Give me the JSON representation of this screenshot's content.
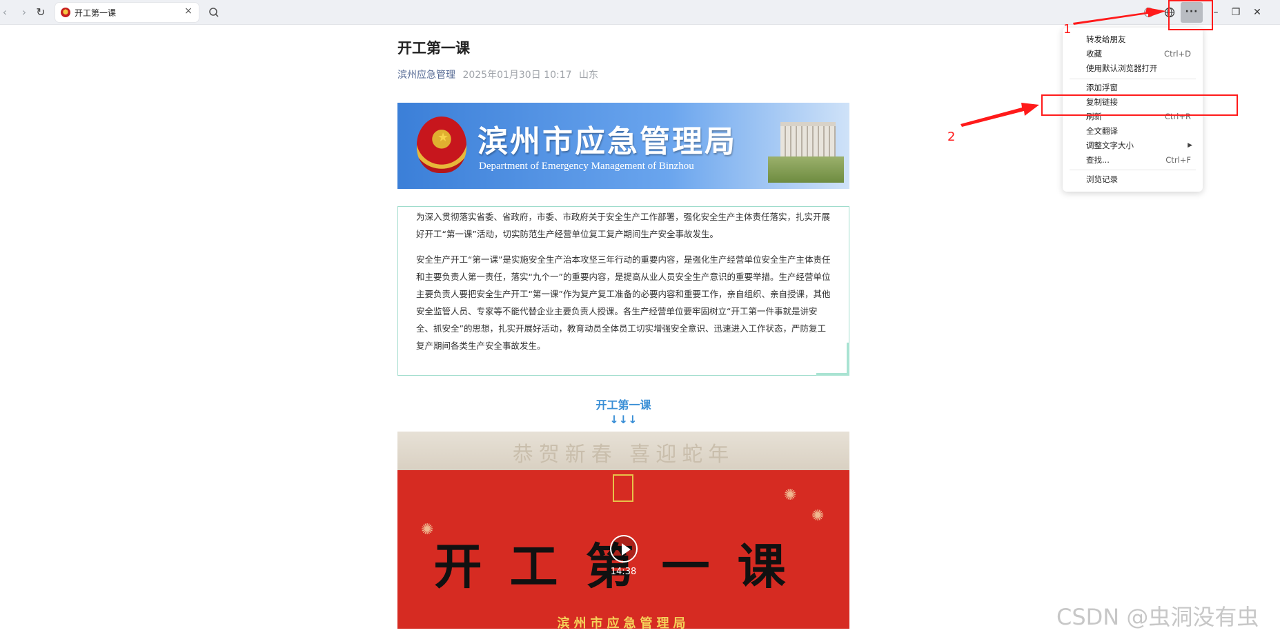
{
  "browser": {
    "tab_title": "开工第一课",
    "tab_close": "×",
    "nav_back": "‹",
    "nav_forward": "›",
    "reload": "↻",
    "more": "···",
    "minimize": "–",
    "restore": "❐",
    "close": "✕"
  },
  "article": {
    "title": "开工第一课",
    "source": "滨州应急管理",
    "date": "2025年01月30日 10:17",
    "location": "山东",
    "banner_cn": "滨州市应急管理局",
    "banner_en": "Department of Emergency Management of Binzhou",
    "intro_p1": "为深入贯彻落实省委、省政府，市委、市政府关于安全生产工作部署，强化安全生产主体责任落实，扎实开展好开工“第一课”活动，切实防范生产经营单位复工复产期间生产安全事故发生。",
    "intro_p2": "安全生产开工“第一课”是实施安全生产治本攻坚三年行动的重要内容，是强化生产经营单位安全生产主体责任和主要负责人第一责任，落实“九个一”的重要内容，是提高从业人员安全生产意识的重要举措。生产经营单位主要负责人要把安全生产开工“第一课”作为复产复工准备的必要内容和重要工作，亲自组织、亲自授课，其他安全监管人员、专家等不能代替企业主要负责人授课。各生产经营单位要牢固树立“开工第一件事就是讲安全、抓安全”的思想，扎实开展好活动，教育动员全体员工切实增强安全意识、迅速进入工作状态，严防复工复产期间各类生产安全事故发生。",
    "section_head": "开工第一课",
    "section_arrows": "↓↓↓",
    "video": {
      "top_text": "恭贺新春 喜迎蛇年",
      "big_text": "开工第一课",
      "duration": "14:38",
      "bottom_text": "滨州市应急管理局"
    }
  },
  "menu": {
    "items": [
      {
        "label": "转发给朋友",
        "shortcut": ""
      },
      {
        "label": "收藏",
        "shortcut": "Ctrl+D"
      },
      {
        "label": "使用默认浏览器打开",
        "shortcut": ""
      },
      {
        "label": "添加浮窗",
        "shortcut": ""
      },
      {
        "label": "复制链接",
        "shortcut": ""
      },
      {
        "label": "刷新",
        "shortcut": "Ctrl+R"
      },
      {
        "label": "全文翻译",
        "shortcut": ""
      },
      {
        "label": "调整文字大小",
        "shortcut": ""
      },
      {
        "label": "查找...",
        "shortcut": "Ctrl+F"
      },
      {
        "label": "浏览记录",
        "shortcut": ""
      }
    ]
  },
  "annotations": {
    "step1": "1",
    "step2": "2",
    "color": "#ff1a1a"
  },
  "watermark": "CSDN @虫洞没有虫"
}
